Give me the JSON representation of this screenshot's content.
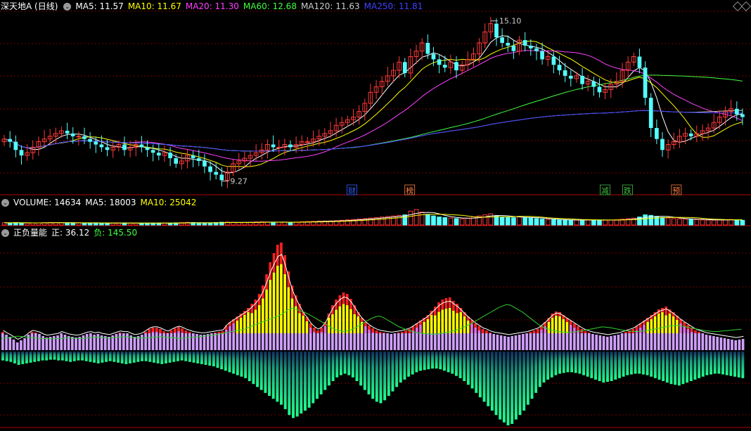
{
  "chart_data": [
    {
      "type": "candlestick",
      "panel": "price",
      "title": "深天地A (日线)",
      "ma_legend": [
        {
          "label": "MA5: 11.57",
          "color": "#ffffff"
        },
        {
          "label": "MA10: 11.67",
          "color": "#ffff00"
        },
        {
          "label": "MA20: 11.30",
          "color": "#ff40ff"
        },
        {
          "label": "MA60: 12.68",
          "color": "#40ff40"
        },
        {
          "label": "MA120: 11.63",
          "color": "#cccccc"
        },
        {
          "label": "MA250: 11.81",
          "color": "#4040ff"
        }
      ],
      "annotations": [
        {
          "label": "15.10",
          "value": 15.1
        },
        {
          "label": "9.27",
          "value": 9.27
        }
      ],
      "event_markers": [
        {
          "label": "财",
          "color": "#3060ff"
        },
        {
          "label": "榜",
          "color": "#ff8040"
        },
        {
          "label": "减",
          "color": "#40c040"
        },
        {
          "label": "跌",
          "color": "#40c040"
        },
        {
          "label": "预",
          "color": "#ff8040"
        }
      ],
      "ylim": [
        9.0,
        15.4
      ],
      "closes": [
        10.8,
        10.7,
        10.4,
        10.2,
        10.3,
        10.5,
        10.7,
        10.8,
        10.9,
        11.0,
        11.1,
        11.0,
        10.9,
        10.9,
        10.8,
        10.7,
        10.6,
        10.5,
        10.4,
        10.5,
        10.6,
        10.4,
        10.5,
        10.6,
        10.5,
        10.4,
        10.3,
        10.2,
        10.3,
        10.1,
        9.9,
        10.0,
        10.2,
        10.1,
        10.0,
        9.8,
        9.6,
        9.5,
        9.3,
        9.6,
        9.9,
        10.0,
        10.1,
        10.2,
        10.3,
        10.4,
        10.6,
        10.5,
        10.5,
        10.6,
        10.5,
        10.6,
        10.7,
        10.7,
        10.8,
        10.9,
        11.0,
        11.1,
        11.3,
        11.4,
        11.5,
        11.6,
        11.8,
        12.1,
        12.5,
        12.7,
        12.9,
        13.1,
        13.3,
        13.6,
        13.2,
        13.8,
        14.0,
        14.3,
        13.9,
        13.7,
        13.5,
        13.4,
        13.6,
        13.3,
        13.5,
        13.7,
        13.9,
        14.3,
        14.7,
        15.0,
        14.5,
        14.3,
        14.2,
        14.0,
        14.4,
        14.2,
        14.1,
        14.0,
        13.7,
        13.8,
        13.5,
        13.3,
        13.1,
        13.0,
        13.1,
        12.8,
        12.9,
        12.7,
        12.5,
        12.6,
        12.8,
        12.9,
        13.3,
        13.6,
        13.8,
        13.4,
        12.3,
        11.2,
        10.8,
        10.4,
        10.6,
        10.7,
        10.9,
        11.0,
        10.9,
        11.0,
        11.1,
        11.2,
        11.4,
        11.6,
        11.8,
        11.9,
        11.7,
        11.6
      ]
    },
    {
      "type": "bar",
      "panel": "volume",
      "title": "VOLUME: 14634",
      "legend": [
        {
          "label": "MA5: 18003",
          "color": "#ffffff"
        },
        {
          "label": "MA10: 25042",
          "color": "#ffff00"
        }
      ],
      "values": [
        2.1,
        2.0,
        2.2,
        2.0,
        1.8,
        1.9,
        2.0,
        2.2,
        2.4,
        2.3,
        2.1,
        2.0,
        1.8,
        1.9,
        1.8,
        1.9,
        2.0,
        1.8,
        1.7,
        1.8,
        1.9,
        2.0,
        1.9,
        1.7,
        1.6,
        1.7,
        1.8,
        1.9,
        1.8,
        1.7,
        2.0,
        2.2,
        2.5,
        2.3,
        2.0,
        1.8,
        1.9,
        2.3,
        2.6,
        2.8,
        2.5,
        2.2,
        2.4,
        2.6,
        2.9,
        3.0,
        2.7,
        2.4,
        2.6,
        2.7,
        2.5,
        2.8,
        3.0,
        3.2,
        3.4,
        3.6,
        3.7,
        3.8,
        4.0,
        4.4,
        4.8,
        5.2,
        5.6,
        6.0,
        6.5,
        7.0,
        7.5,
        8.0,
        8.5,
        9.0,
        9.5,
        13.0,
        14.5,
        12.0,
        10.0,
        8.5,
        7.5,
        7.0,
        6.5,
        6.0,
        5.8,
        6.5,
        7.5,
        8.5,
        9.5,
        10.5,
        8.5,
        7.5,
        7.0,
        6.8,
        8.0,
        7.0,
        6.5,
        6.0,
        5.5,
        5.2,
        5.0,
        4.8,
        4.6,
        4.5,
        4.6,
        4.8,
        5.0,
        4.6,
        4.4,
        4.5,
        4.7,
        5.0,
        5.5,
        6.0,
        6.5,
        7.5,
        9.5,
        9.0,
        8.0,
        7.0,
        6.5,
        6.0,
        5.8,
        5.5,
        5.2,
        5.0,
        4.8,
        4.6,
        4.5,
        4.7,
        4.9,
        5.0,
        4.6,
        4.4
      ]
    },
    {
      "type": "bar",
      "panel": "indicator",
      "title": "正负量能",
      "legend": [
        {
          "label": "正: 36.12",
          "color": "#ffffff"
        },
        {
          "label": "负: 145.50",
          "color": "#40ff40"
        }
      ],
      "positive": [
        26,
        22,
        19,
        15,
        11,
        14,
        17,
        22,
        26,
        25,
        23,
        20,
        18,
        19,
        20,
        21,
        24,
        22,
        20,
        19,
        18,
        19,
        21,
        23,
        24,
        22,
        23,
        21,
        20,
        19,
        21,
        23,
        25,
        24,
        24,
        21,
        19,
        20,
        22,
        26,
        30,
        32,
        32,
        30,
        27,
        25,
        28,
        31,
        33,
        31,
        28,
        26,
        24,
        23,
        22,
        22,
        23,
        24,
        25,
        26,
        27,
        35,
        40,
        44,
        48,
        52,
        56,
        60,
        66,
        72,
        80,
        92,
        108,
        125,
        138,
        150,
        153,
        135,
        112,
        92,
        78,
        66,
        55,
        47,
        38,
        32,
        28,
        32,
        40,
        52,
        64,
        72,
        78,
        82,
        80,
        73,
        64,
        54,
        46,
        40,
        35,
        31,
        28,
        26,
        25,
        24,
        23,
        24,
        25,
        26,
        28,
        30,
        34,
        38,
        42,
        46,
        50,
        56,
        62,
        68,
        72,
        74,
        75,
        70,
        66,
        60,
        54,
        48,
        43,
        38,
        34,
        30,
        28,
        25,
        23,
        22,
        21,
        20,
        19,
        20,
        21,
        22,
        23,
        24,
        26,
        28,
        30,
        35,
        40,
        46,
        52,
        55,
        54,
        50,
        46,
        42,
        38,
        34,
        30,
        27,
        25,
        23,
        22,
        21,
        20,
        19,
        20,
        21,
        22,
        24,
        26,
        28,
        30,
        34,
        38,
        42,
        46,
        50,
        54,
        58,
        60,
        62,
        58,
        54,
        49,
        44,
        40,
        36,
        32,
        28,
        26,
        24,
        22,
        21,
        20,
        19,
        18,
        17,
        16,
        15,
        14,
        15,
        16
      ],
      "negative": [
        12,
        13,
        14,
        16,
        18,
        17,
        16,
        15,
        14,
        13,
        12,
        12,
        11,
        11,
        12,
        12,
        13,
        14,
        13,
        12,
        12,
        13,
        14,
        15,
        16,
        15,
        14,
        13,
        14,
        15,
        16,
        17,
        16,
        15,
        14,
        13,
        13,
        14,
        15,
        16,
        17,
        16,
        15,
        14,
        13,
        12,
        13,
        14,
        15,
        16,
        17,
        18,
        19,
        20,
        22,
        24,
        26,
        28,
        30,
        32,
        34,
        36,
        40,
        44,
        48,
        52,
        56,
        60,
        64,
        68,
        72,
        78,
        86,
        90,
        88,
        84,
        80,
        76,
        70,
        64,
        58,
        52,
        46,
        40,
        35,
        32,
        30,
        32,
        35,
        40,
        46,
        52,
        58,
        64,
        68,
        70,
        66,
        60,
        54,
        48,
        42,
        38,
        34,
        31,
        28,
        26,
        25,
        24,
        23,
        23,
        24,
        26,
        28,
        30,
        33,
        36,
        40,
        45,
        50,
        56,
        62,
        68,
        74,
        80,
        86,
        92,
        96,
        100,
        98,
        92,
        86,
        80,
        72,
        64,
        56,
        48,
        42,
        38,
        35,
        32,
        30,
        29,
        28,
        28,
        29,
        30,
        32,
        34,
        36,
        38,
        40,
        42,
        41,
        40,
        38,
        36,
        34,
        32,
        31,
        30,
        30,
        31,
        32,
        34,
        36,
        38,
        40,
        42,
        44,
        45,
        46,
        44,
        42,
        40,
        38,
        36,
        34,
        32,
        31,
        30,
        30,
        31,
        32,
        33,
        34,
        35,
        36
      ]
    }
  ]
}
